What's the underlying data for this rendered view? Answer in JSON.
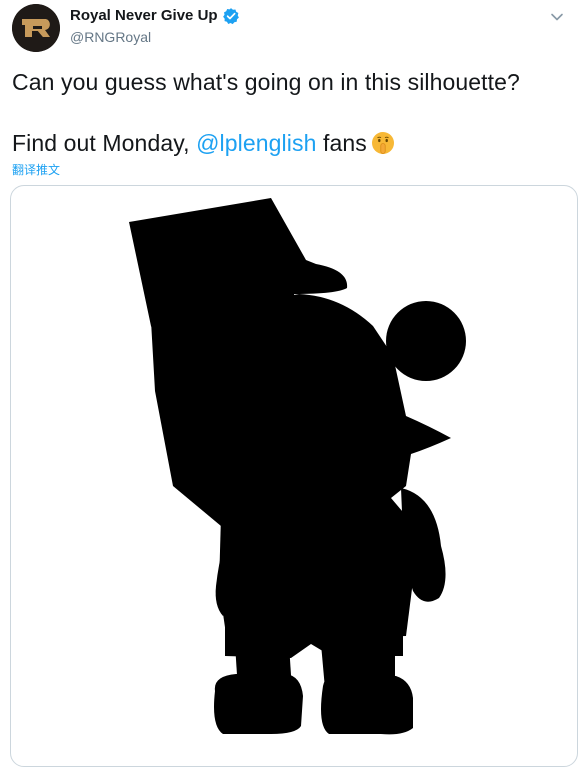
{
  "author": {
    "display_name": "Royal Never Give Up",
    "handle": "@RNGRoyal",
    "verified": true,
    "avatar_icon": "rng-logo-icon"
  },
  "tweet": {
    "line1": "Can you guess what's going on in this silhouette?",
    "line2_prefix": "Find out Monday, ",
    "mention": "@lplenglish",
    "line2_suffix": " fans",
    "emoji": "shushing-face-emoji",
    "translate_label": "翻译推文"
  },
  "media": {
    "description_icon": "silhouette-image"
  },
  "colors": {
    "link": "#1da1f2",
    "text": "#14171a",
    "muted": "#657786",
    "border": "#ccd6dd"
  }
}
